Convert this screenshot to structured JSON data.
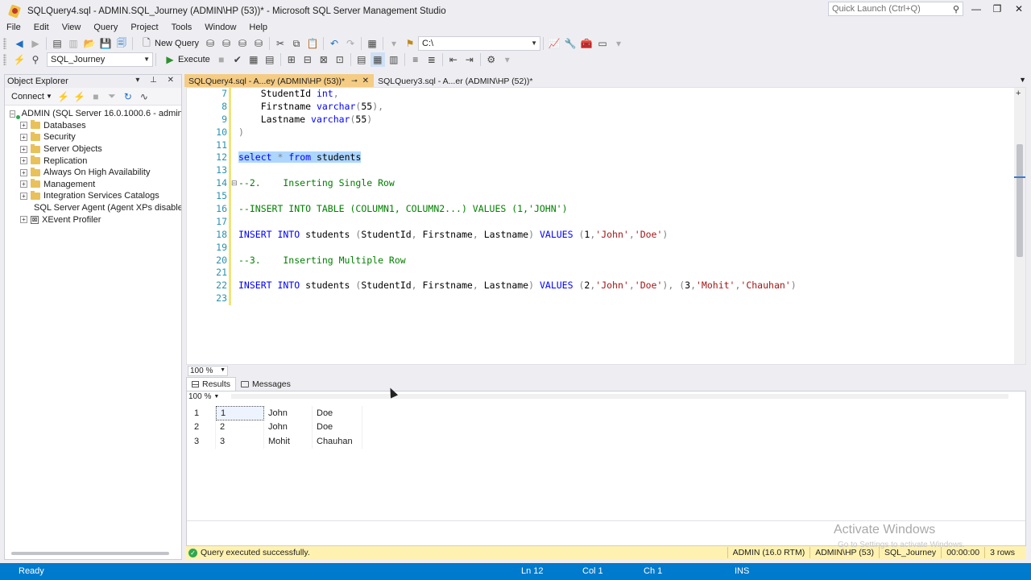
{
  "window": {
    "title": "SQLQuery4.sql - ADMIN.SQL_Journey (ADMIN\\HP (53))* - Microsoft SQL Server Management Studio",
    "quick_launch_placeholder": "Quick Launch (Ctrl+Q)"
  },
  "menu": [
    "File",
    "Edit",
    "View",
    "Query",
    "Project",
    "Tools",
    "Window",
    "Help"
  ],
  "toolbar": {
    "new_query_label": "New Query",
    "path_value": "C:\\",
    "database_value": "SQL_Journey",
    "execute_label": "Execute"
  },
  "object_explorer": {
    "title": "Object Explorer",
    "connect_label": "Connect",
    "server_node": "ADMIN (SQL Server 16.0.1000.6 - admin\\HP)",
    "nodes": [
      "Databases",
      "Security",
      "Server Objects",
      "Replication",
      "Always On High Availability",
      "Management",
      "Integration Services Catalogs",
      "SQL Server Agent (Agent XPs disabled)",
      "XEvent Profiler"
    ]
  },
  "tabs": [
    {
      "label": "SQLQuery4.sql - A...ey (ADMIN\\HP (53))*",
      "active": true
    },
    {
      "label": "SQLQuery3.sql - A...er (ADMIN\\HP (52))*",
      "active": false
    }
  ],
  "editor": {
    "line_numbers": [
      "7",
      "8",
      "9",
      "10",
      "11",
      "12",
      "13",
      "14",
      "15",
      "16",
      "17",
      "18",
      "19",
      "20",
      "21",
      "22",
      "23"
    ],
    "zoom": "100 %"
  },
  "results": {
    "tabs": [
      "Results",
      "Messages"
    ],
    "zoom": "100 %",
    "rows": [
      {
        "num": "1",
        "id": "1",
        "first": "John",
        "last": "Doe"
      },
      {
        "num": "2",
        "id": "2",
        "first": "John",
        "last": "Doe"
      },
      {
        "num": "3",
        "id": "3",
        "first": "Mohit",
        "last": "Chauhan"
      }
    ]
  },
  "query_status": {
    "message": "Query executed successfully.",
    "server": "ADMIN (16.0 RTM)",
    "user": "ADMIN\\HP (53)",
    "database": "SQL_Journey",
    "elapsed": "00:00:00",
    "rows": "3 rows"
  },
  "watermark": {
    "line1": "Activate Windows",
    "line2": "Go to Settings to activate Windows."
  },
  "statusbar": {
    "ready": "Ready",
    "ln": "Ln 12",
    "col": "Col 1",
    "ch": "Ch 1",
    "ins": "INS"
  }
}
